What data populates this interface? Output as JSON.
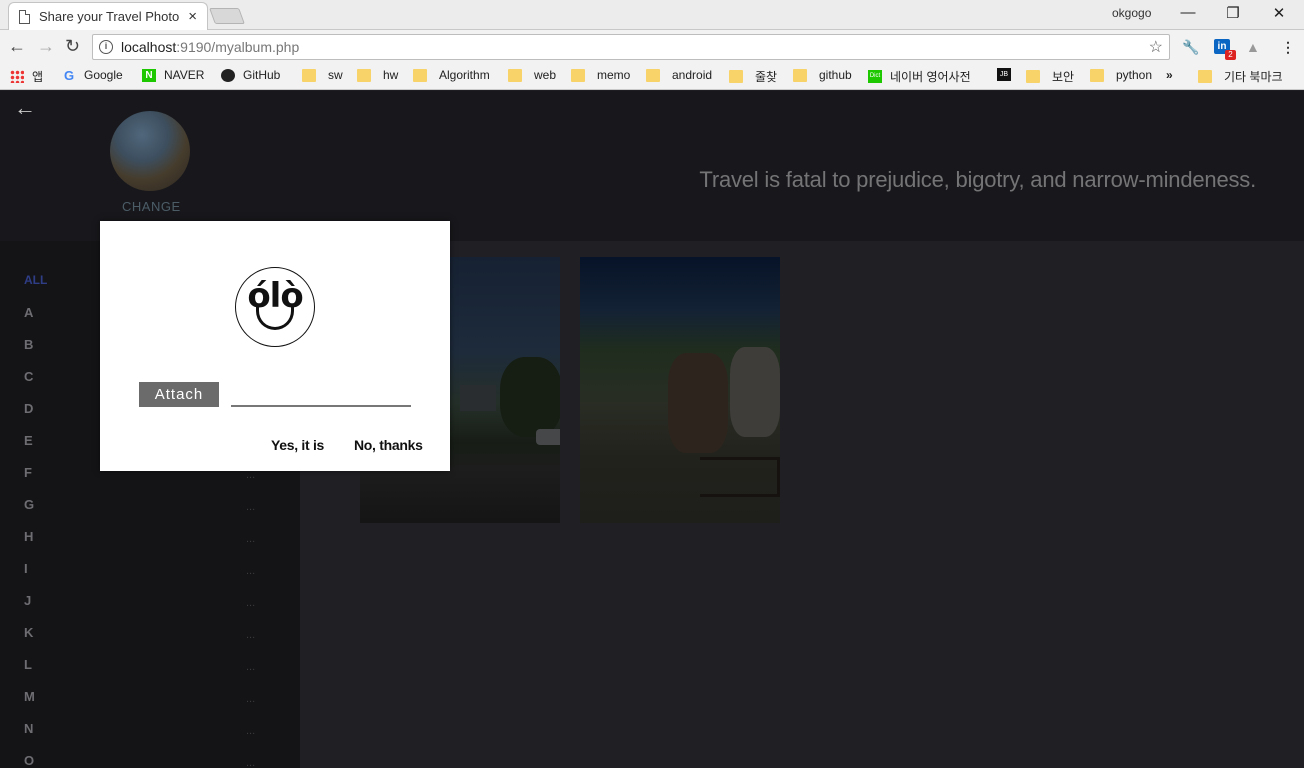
{
  "browser": {
    "tab_title": "Share your Travel Photo",
    "tab_close": "×",
    "profile_name": "okgogo",
    "window_controls": [
      "—",
      "❐",
      "✕"
    ],
    "url_host": "localhost",
    "url_path": ":9190/myalbum.php",
    "bookmarks": [
      {
        "label": "앱",
        "icon": "apps-icon"
      },
      {
        "label": "Google",
        "icon": "google-icon"
      },
      {
        "label": "NAVER",
        "icon": "naver-icon"
      },
      {
        "label": "GitHub",
        "icon": "github-icon"
      },
      {
        "label": "sw",
        "icon": "folder-icon"
      },
      {
        "label": "hw",
        "icon": "folder-icon"
      },
      {
        "label": "Algorithm",
        "icon": "folder-icon"
      },
      {
        "label": "web",
        "icon": "folder-icon"
      },
      {
        "label": "memo",
        "icon": "folder-icon"
      },
      {
        "label": "android",
        "icon": "folder-icon"
      },
      {
        "label": "줄찾",
        "icon": "folder-icon"
      },
      {
        "label": "github",
        "icon": "folder-icon"
      },
      {
        "label": "네이버 영어사전",
        "icon": "dict-icon"
      },
      {
        "label": "",
        "icon": "jb-icon"
      },
      {
        "label": "보안",
        "icon": "folder-icon"
      },
      {
        "label": "python",
        "icon": "folder-icon"
      }
    ],
    "bookmarks_overflow": "»",
    "other_bookmarks": "기타 북마크",
    "extension_badge": "2"
  },
  "page": {
    "change_label": "CHANGE",
    "quote": "Travel is fatal to prejudice, bigotry, and narrow-mindeness.",
    "filter_all": "ALL",
    "letters": [
      "A",
      "B",
      "C",
      "D",
      "E",
      "F",
      "G",
      "H",
      "I",
      "J",
      "K",
      "L",
      "M",
      "N",
      "O"
    ],
    "dots": "...",
    "colors": {
      "all_filter": "#2f3d86",
      "background": "#1f1f24"
    }
  },
  "modal": {
    "logo_text": "ólò",
    "attach_label": "Attach",
    "attach_value": "",
    "confirm_label": "Yes, it is",
    "cancel_label": "No, thanks"
  }
}
